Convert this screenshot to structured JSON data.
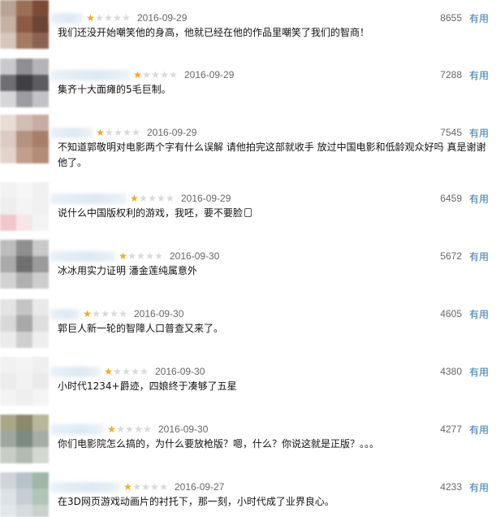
{
  "reviews": [
    {
      "rating": 1,
      "date": "2016-09-29",
      "votes": "8655",
      "useful_label": "有用",
      "text": "我们还没开始嘲笑他的身高，他就已经在他的作品里嘲笑了我们的智商！"
    },
    {
      "rating": 1,
      "date": "2016-09-29",
      "votes": "7288",
      "useful_label": "有用",
      "text": "集齐十大面瘫的5毛巨制。"
    },
    {
      "rating": 1,
      "date": "2016-09-29",
      "votes": "7545",
      "useful_label": "有用",
      "text": "不知道郭敬明对电影两个字有什么误解 请他拍完这部就收手 放过中国电影和低龄观众好吗 真是谢谢他了。"
    },
    {
      "rating": 1,
      "date": "2016-09-29",
      "votes": "6459",
      "useful_label": "有用",
      "text": "说什么中国版权利的游戏，我呸，要不要脸"
    },
    {
      "rating": 1,
      "date": "2016-09-30",
      "votes": "5672",
      "useful_label": "有用",
      "text": "冰冰用实力证明 潘金莲纯属意外"
    },
    {
      "rating": 1,
      "date": "2016-09-30",
      "votes": "4605",
      "useful_label": "有用",
      "text": "郭巨人新一轮的智障人口普查又来了。"
    },
    {
      "rating": 1,
      "date": "2016-09-30",
      "votes": "4380",
      "useful_label": "有用",
      "text": "小时代1234+爵迹，四娘终于凑够了五星"
    },
    {
      "rating": 1,
      "date": "2016-09-30",
      "votes": "4277",
      "useful_label": "有用",
      "text": "你们电影院怎么搞的，为什么要放枪版？嗯，什么？你说这就是正版？。。。"
    },
    {
      "rating": 1,
      "date": "2016-09-27",
      "votes": "4233",
      "useful_label": "有用",
      "text": "在3D网页游戏动画片的衬托下，那一刻，小时代成了业界良心。"
    }
  ],
  "colors": {
    "star_on": "#f5a623",
    "star_off": "#d9d9d9",
    "link": "#3377aa",
    "meta": "#666666",
    "text": "#111111"
  },
  "icons": {
    "star_filled": "star-filled-icon",
    "star_empty": "star-empty-icon",
    "emoji": "emoji-icon"
  }
}
